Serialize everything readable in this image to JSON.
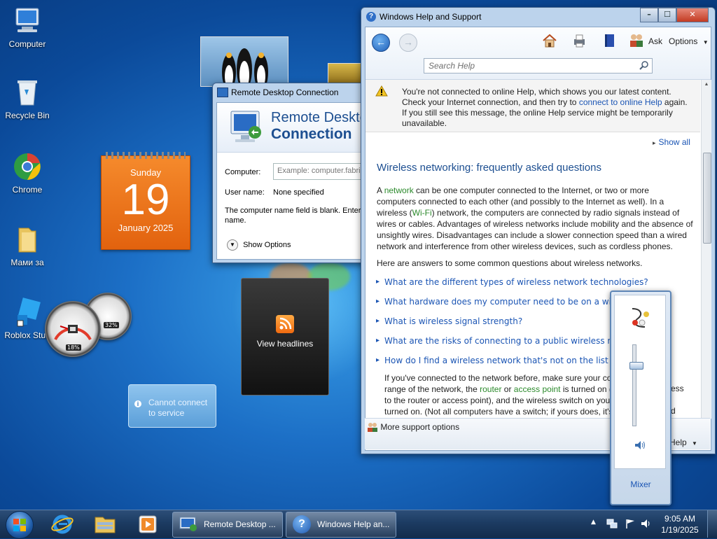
{
  "desktop": {
    "icons": [
      {
        "label": "Computer"
      },
      {
        "label": "Recycle Bin"
      },
      {
        "label": "Chrome"
      },
      {
        "label": "Мами за"
      },
      {
        "label": "Roblox Stud"
      }
    ]
  },
  "calendar": {
    "weekday": "Sunday",
    "day": "19",
    "month_year": "January 2025"
  },
  "meters": {
    "cpu": "18%",
    "ram": "32%"
  },
  "feed": {
    "label": "View headlines"
  },
  "cannot_connect": {
    "line1": "Cannot connect",
    "line2": "to service"
  },
  "rdc": {
    "title": "Remote Desktop Connection",
    "header_line1": "Remote Deskto",
    "header_line2": "Connection",
    "computer_label": "Computer:",
    "computer_placeholder": "Example: computer.fabrik",
    "username_label": "User name:",
    "username_value": "None specified",
    "note": "The computer name field is blank. Enter a",
    "note2": "name.",
    "show_options": "Show Options"
  },
  "help": {
    "title": "Windows Help and Support",
    "ask": "Ask",
    "options": "Options",
    "search_placeholder": "Search Help",
    "warning_l1": "You're not connected to online Help, which shows you our latest content.",
    "warning_l2a": "Check your Internet connection, and then try to ",
    "warning_link": "connect to online Help",
    "warning_l2b": " again.",
    "warning_l3": "If you still see this message, the online Help service might be temporarily",
    "warning_l4": "unavailable.",
    "show_all": "Show all",
    "heading": "Wireless networking: frequently asked questions",
    "p1_a": "A ",
    "p1_network": "network",
    "p1_b": " can be one computer connected to the Internet, or two or more",
    "p1_l2": "computers connected to each other (and possibly to the Internet as well). In a",
    "p1_l3a": "wireless (",
    "p1_wifi": "Wi-Fi",
    "p1_l3b": ") network, the computers are connected by radio signals instead of",
    "p1_l4": "wires or cables. Advantages of wireless networks include mobility and the absence of",
    "p1_l5": "unsightly wires. Disadvantages can include a slower connection speed than a wired",
    "p1_l6": "network and interference from other wireless devices, such as cordless phones.",
    "p2": "Here are answers to some common questions about wireless networks.",
    "questions": [
      "What are the different types of wireless network technologies?",
      "What hardware does my computer need to be on a wireless n",
      "What is wireless signal strength?",
      "What are the risks of connecting to a public wireless network?",
      "How do I find a wireless network that's not on the list of availa"
    ],
    "ans_l1": "If you've connected to the network before, make sure your co",
    "ans_l2a": "range of the network, the ",
    "ans_router": "router",
    "ans_or": " or ",
    "ans_ap": "access point",
    "ans_l2b": " is turned on (",
    "ans_l2c": "ess",
    "ans_l3": "to the router or access point), and the wireless switch on your",
    "ans_l4": "turned on. (Not all computers have a switch; if yours does, it's",
    "ans_l4b": "d",
    "more_support": "More support options",
    "help_menu": "Help"
  },
  "volume": {
    "mixer": "Mixer",
    "level": 0.75
  },
  "taskbar": {
    "task1": "Remote Desktop ...",
    "task2": "Windows Help an...",
    "time": "9:05 AM",
    "date": "1/19/2025"
  }
}
